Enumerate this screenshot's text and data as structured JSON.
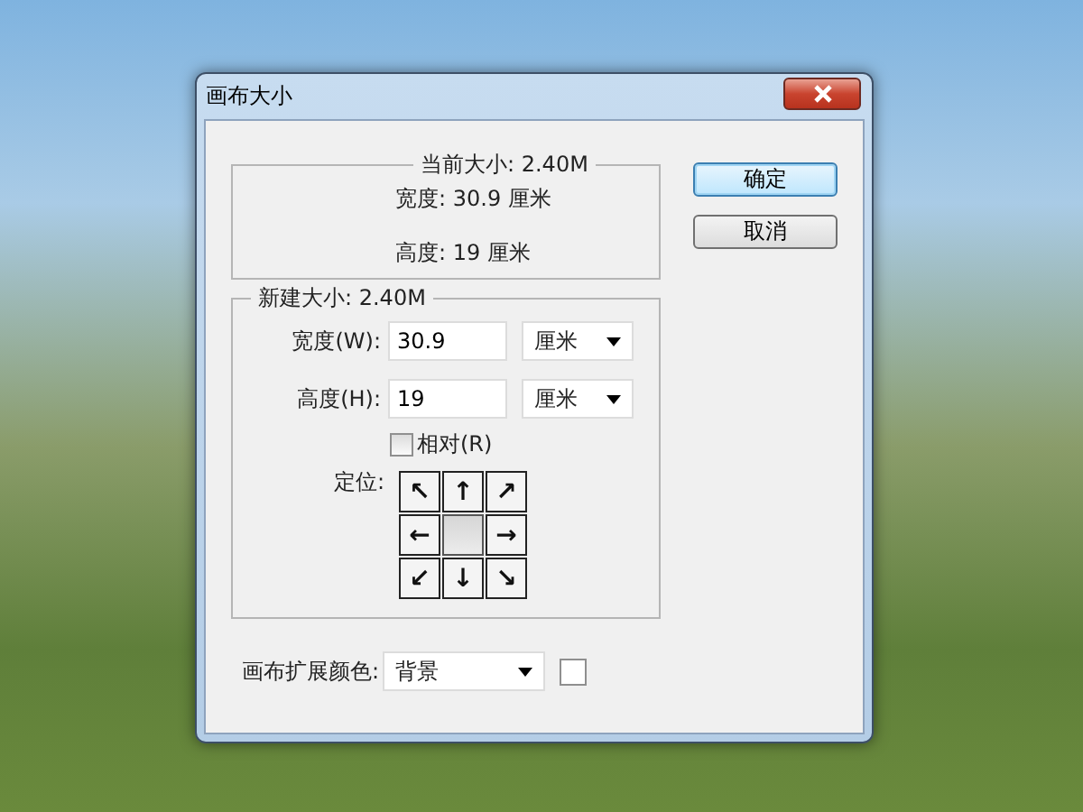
{
  "window": {
    "title": "画布大小"
  },
  "current_size": {
    "legend": "当前大小: 2.40M",
    "width": "宽度:  30.9 厘米",
    "height": "高度:  19 厘米"
  },
  "buttons": [
    {
      "label": "确定",
      "selected": true
    },
    {
      "label": "取消",
      "selected": false
    }
  ],
  "new_size": {
    "legend": "新建大小: 2.40M",
    "fields": [
      {
        "label": "宽度(W):",
        "value": "30.9",
        "unit": "厘米"
      },
      {
        "label": "高度(H):",
        "value": "19",
        "unit": "厘米"
      }
    ],
    "relative": {
      "label": "相对(R)",
      "checked": false
    },
    "anchor": {
      "label": "定位:",
      "cells": [
        {
          "arrow": "↖",
          "selected": false
        },
        {
          "arrow": "↑",
          "selected": false
        },
        {
          "arrow": "↗",
          "selected": false
        },
        {
          "arrow": "←",
          "selected": false
        },
        {
          "selected": true
        },
        {
          "arrow": "→",
          "selected": false
        },
        {
          "arrow": "↙",
          "selected": false
        },
        {
          "arrow": "↓",
          "selected": false
        },
        {
          "arrow": "↘",
          "selected": false
        }
      ]
    }
  },
  "extension_color": {
    "label": "画布扩展颜色:",
    "value": "背景"
  }
}
